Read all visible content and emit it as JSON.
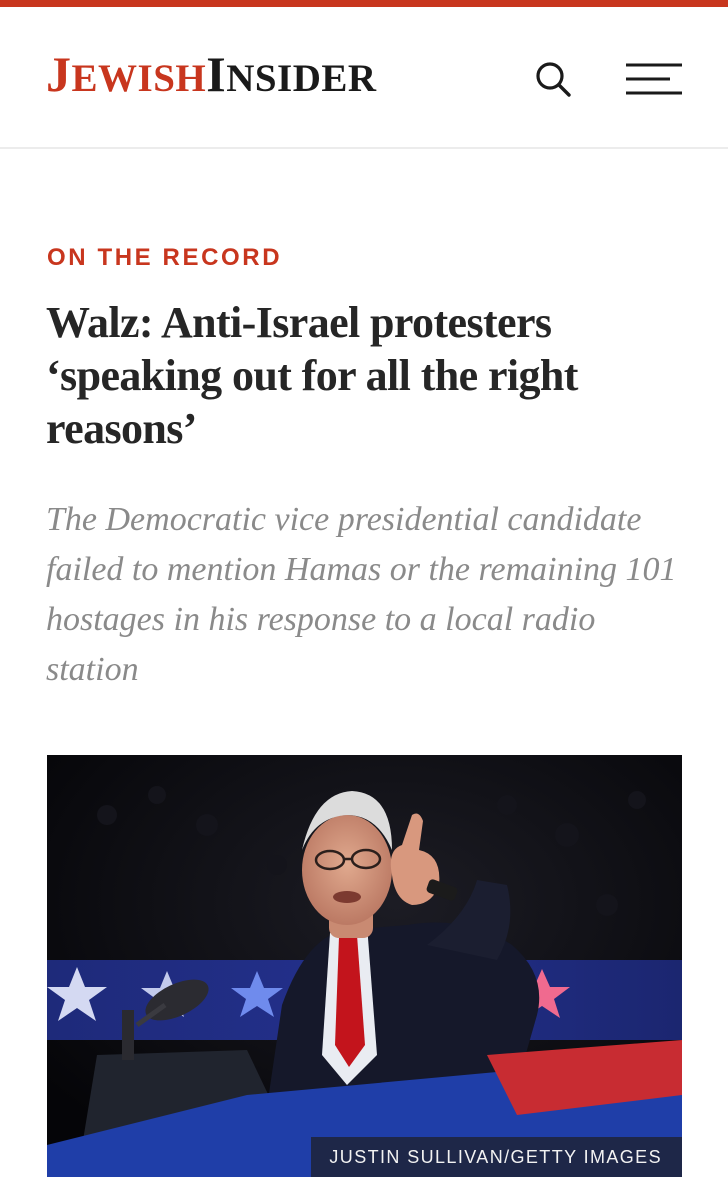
{
  "header": {
    "logo": {
      "jewish_initial": "J",
      "jewish_rest": "EWISH",
      "insider_initial": "I",
      "insider_rest": "NSIDER"
    },
    "search_icon": "search-icon",
    "menu_icon": "menu-icon"
  },
  "colors": {
    "brand_red": "#c8361e",
    "headline": "#262626",
    "dek": "#8a8a8a"
  },
  "article": {
    "category": "ON THE RECORD",
    "headline": "Walz: Anti-Israel protesters ‘speaking out for all the right reasons’",
    "dek": "The Democratic vice presidential candidate failed to mention Hamas or the remaining 101 hostages in his response to a local radio station",
    "image": {
      "credit": "JUSTIN SULLIVAN/GETTY IMAGES"
    }
  }
}
